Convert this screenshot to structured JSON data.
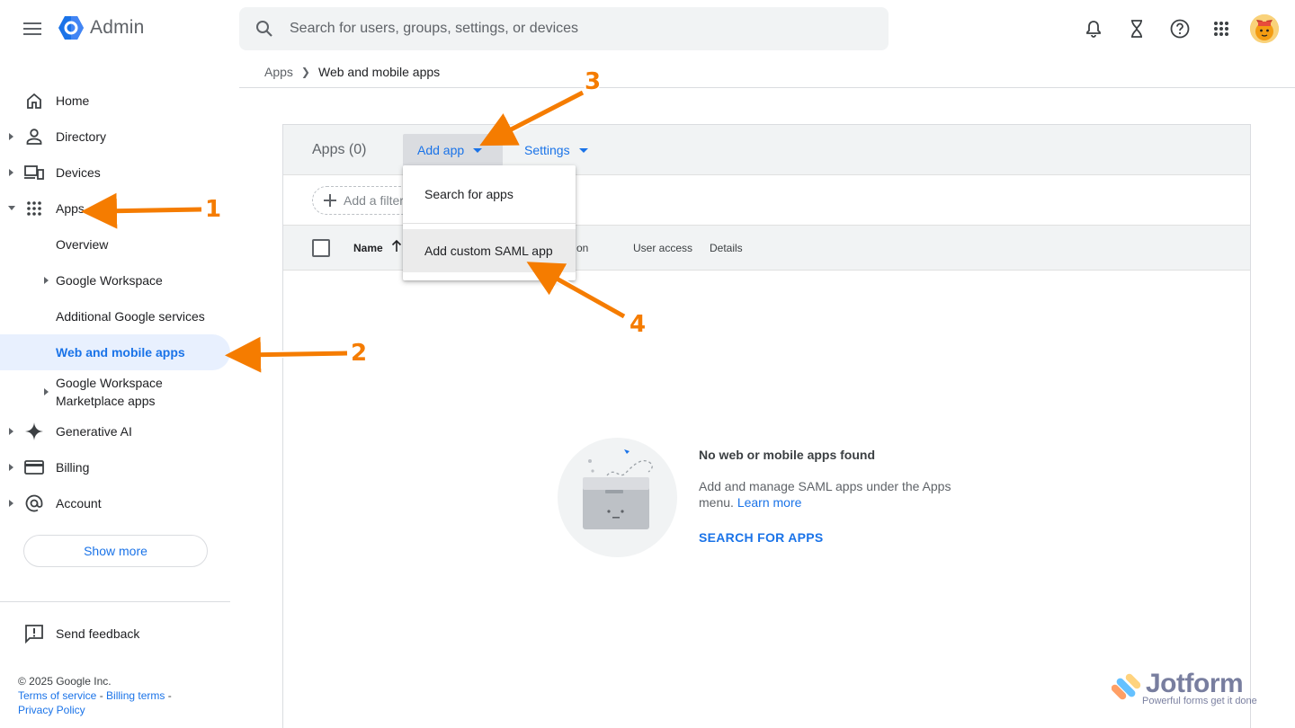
{
  "header": {
    "app_name": "Admin",
    "search_placeholder": "Search for users, groups, settings, or devices",
    "icons": [
      "menu-icon",
      "admin-logo",
      "search-icon",
      "notifications-icon",
      "tasks-hourglass-icon",
      "help-icon",
      "apps-grid-icon",
      "avatar"
    ]
  },
  "breadcrumb": {
    "root": "Apps",
    "current": "Web and mobile apps"
  },
  "sidebar": {
    "items": [
      {
        "label": "Home",
        "icon": "home-icon"
      },
      {
        "label": "Directory",
        "icon": "person-icon"
      },
      {
        "label": "Devices",
        "icon": "devices-icon"
      },
      {
        "label": "Apps",
        "icon": "apps-grid-icon"
      },
      {
        "label": "Overview"
      },
      {
        "label": "Google Workspace"
      },
      {
        "label": "Additional Google services"
      },
      {
        "label": "Web and mobile apps"
      },
      {
        "label": "Google Workspace Marketplace apps"
      },
      {
        "label": "Generative AI",
        "icon": "sparkle-icon"
      },
      {
        "label": "Billing",
        "icon": "credit-card-icon"
      },
      {
        "label": "Account",
        "icon": "at-sign-icon"
      }
    ],
    "show_more": "Show more",
    "send_feedback": "Send feedback",
    "footer": {
      "copyright": "© 2025 Google Inc.",
      "terms": "Terms of service",
      "billing_terms": "Billing terms",
      "privacy": "Privacy Policy",
      "dash": "-"
    }
  },
  "main": {
    "apps_count": "Apps (0)",
    "add_app": "Add app",
    "settings": "Settings",
    "filter": "Add a filter",
    "columns": {
      "name": "Name",
      "hidden_partial": "on",
      "user_access": "User access",
      "details": "Details"
    },
    "dropdown": {
      "search_for_apps": "Search for apps",
      "add_custom_saml": "Add custom SAML app"
    },
    "empty_state": {
      "title": "No web or mobile apps found",
      "desc": "Add and manage SAML apps under the Apps menu.",
      "learn_more": "Learn more",
      "cta": "SEARCH FOR APPS"
    }
  },
  "annotations": {
    "color": "#f57c00",
    "steps": [
      "1",
      "2",
      "3",
      "4"
    ]
  },
  "watermark": {
    "name": "Jotform",
    "tagline": "Powerful forms get it done"
  },
  "colors": {
    "accent": "#1a73e8",
    "active_bg": "#e8f0fe",
    "header_bg": "#f1f3f4"
  }
}
